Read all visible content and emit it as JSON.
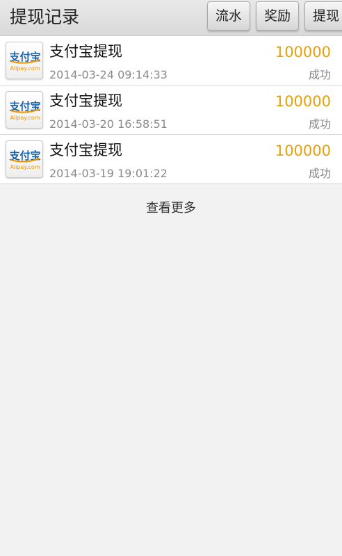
{
  "header": {
    "title": "提现记录",
    "buttons": {
      "flow": "流水",
      "reward": "奖励",
      "withdraw": "提现"
    }
  },
  "records": [
    {
      "title": "支付宝提现",
      "amount": "100000",
      "time": "2014-03-24 09:14:33",
      "status": "成功",
      "logo": {
        "cn": "支付宝",
        "en": "Alipay.com"
      }
    },
    {
      "title": "支付宝提现",
      "amount": "100000",
      "time": "2014-03-20 16:58:51",
      "status": "成功",
      "logo": {
        "cn": "支付宝",
        "en": "Alipay.com"
      }
    },
    {
      "title": "支付宝提现",
      "amount": "100000",
      "time": "2014-03-19 19:01:22",
      "status": "成功",
      "logo": {
        "cn": "支付宝",
        "en": "Alipay.com"
      }
    }
  ],
  "load_more": "查看更多",
  "colors": {
    "amount": "#e6a10a",
    "alipay_blue": "#1a63b0",
    "alipay_orange": "#f29600"
  }
}
